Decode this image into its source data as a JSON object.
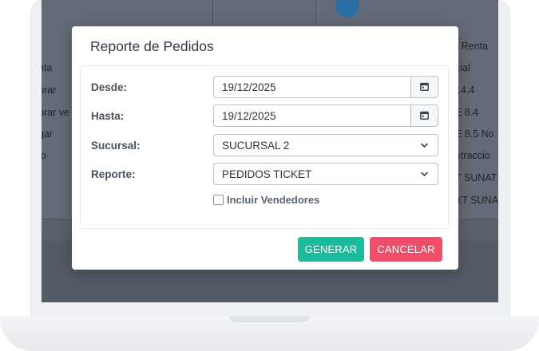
{
  "background_app": {
    "left_items": [
      "nta",
      "brar",
      "brar ve",
      "gar",
      "io"
    ],
    "right_items": [
      "- Renta",
      "cial",
      "14.4",
      "E 8.4",
      "E 8.5 No",
      "etraccio",
      "T SUNAT",
      "XT SUNA"
    ]
  },
  "modal": {
    "title": "Reporte de Pedidos",
    "fields": {
      "desde": {
        "label": "Desde:",
        "value": "19/12/2025"
      },
      "hasta": {
        "label": "Hasta:",
        "value": "19/12/2025"
      },
      "sucursal": {
        "label": "Sucursal:",
        "value": "SUCURSAL 2"
      },
      "reporte": {
        "label": "Reporte:",
        "value": "PEDIDOS TICKET"
      }
    },
    "checkbox": {
      "label": "Incluir Vendedores",
      "checked": false
    },
    "buttons": {
      "generar": "GENERAR",
      "cancelar": "CANCELAR"
    },
    "colors": {
      "generar": "#1abc9c",
      "cancelar": "#ef4d6a"
    },
    "icons": {
      "date": "calendar-icon",
      "select": "chevron-down-icon"
    }
  }
}
